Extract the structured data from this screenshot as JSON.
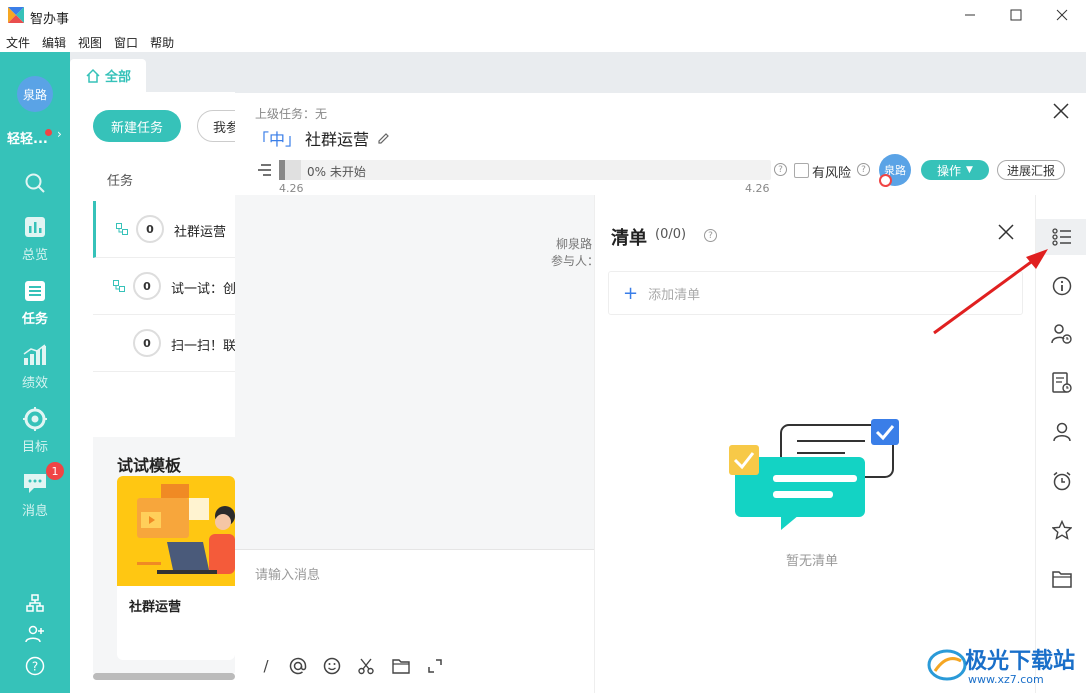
{
  "window": {
    "title": "智办事"
  },
  "menu": [
    "文件",
    "编辑",
    "视图",
    "窗口",
    "帮助"
  ],
  "rail": {
    "avatar_text": "泉路",
    "username": "轻轻...",
    "nav": [
      {
        "label": "总览",
        "icon": "chart-icon"
      },
      {
        "label": "任务",
        "icon": "list-icon",
        "active": true
      },
      {
        "label": "绩效",
        "icon": "bar-growth-icon"
      },
      {
        "label": "目标",
        "icon": "target-icon"
      },
      {
        "label": "消息",
        "icon": "message-icon",
        "badge": "1"
      }
    ]
  },
  "tabs": {
    "all_label": "全部"
  },
  "tasks": {
    "new_button": "新建任务",
    "mine_button": "我参",
    "column_label": "任务",
    "rows": [
      {
        "count": "0",
        "title": "社群运营",
        "has_sub": true
      },
      {
        "count": "0",
        "title": "试一试：创",
        "has_sub": true
      },
      {
        "count": "0",
        "title": "扫一扫！联",
        "has_sub": false
      }
    ]
  },
  "templates": {
    "section_title": "试试模板",
    "card_name": "社群运营"
  },
  "detail": {
    "parent_task": "上级任务：无",
    "priority": "「中」",
    "title": "社群运营",
    "progress_text": "0% 未开始",
    "progress": 0,
    "date_start": "4.26",
    "date_end": "4.26",
    "risk_label": "有风险",
    "assignee_text": "泉路",
    "ops_button": "操作",
    "report_button": "进展汇报",
    "creator_line": "柳泉路",
    "participant_line": "参与人：",
    "message_placeholder": "请输入消息"
  },
  "checklist": {
    "title": "清单",
    "count": "(0/0)",
    "add_placeholder": "添加清单",
    "empty_text": "暂无清单"
  },
  "right_sidebar": [
    "checklist-icon",
    "info-icon",
    "user-clock-icon",
    "doc-clock-icon",
    "person-icon",
    "alarm-icon",
    "star-icon",
    "folder-icon"
  ],
  "watermark": {
    "text": "极光下载站",
    "url": "www.xz7.com"
  },
  "colors": {
    "accent": "#36c2b9",
    "blue": "#3a7ee8",
    "badge": "#f04545"
  }
}
